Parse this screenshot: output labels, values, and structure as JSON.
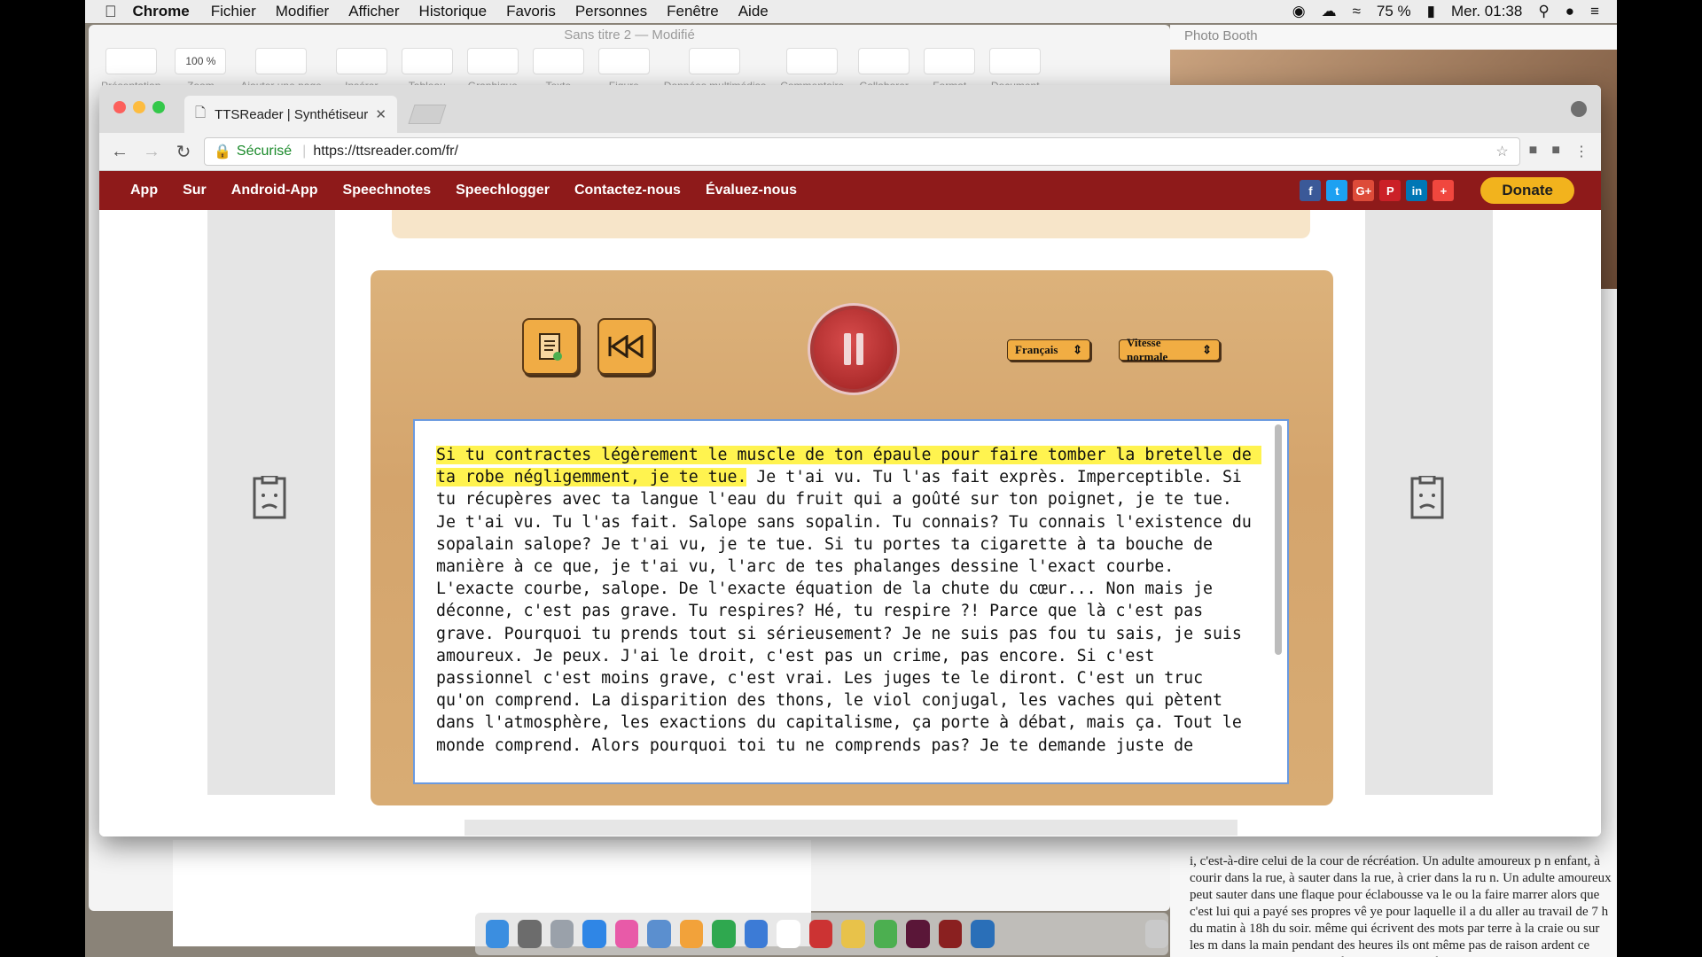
{
  "menubar": {
    "app": "Chrome",
    "items": [
      "Fichier",
      "Modifier",
      "Afficher",
      "Historique",
      "Favoris",
      "Personnes",
      "Fenêtre",
      "Aide"
    ],
    "battery": "75 %",
    "clock": "Mer. 01:38"
  },
  "pages": {
    "title": "Sans titre 2 — Modifié",
    "zoom": "100 %",
    "tools": [
      "Présentation",
      "Zoom",
      "Ajouter une page",
      "Insérer",
      "Tableau",
      "Graphique",
      "Texte",
      "Figure",
      "Données multimédias",
      "Commentaire",
      "Collaborer",
      "Format",
      "Document"
    ]
  },
  "photobooth": {
    "title": "Photo Booth",
    "text": "i, c'est-à-dire celui de la cour de récréation. Un adulte amoureux p n enfant, à courir dans la rue, à sauter dans la rue, à crier dans la ru n. Un adulte amoureux peut sauter dans une flaque pour éclabousse va le ou la faire marrer alors que c'est lui qui a payé ses propres vê ye pour laquelle il a du aller au travail de 7 h du matin à 18h du soir. même qui écrivent des mots par terre à la craie ou sur les m dans la main pendant des heures ils ont même pas de raison ardent ce qu'il y a autour et ils ne s'arrêtent que pour se faire"
  },
  "chrome": {
    "tab_title": "TTSReader | Synthétiseur voc",
    "secure_label": "Sécurisé",
    "url": "https://ttsreader.com/fr/"
  },
  "site": {
    "nav": [
      "App",
      "Sur",
      "Android-App",
      "Speechnotes",
      "Speechlogger",
      "Contactez-nous",
      "Évaluez-nous"
    ],
    "donate": "Donate"
  },
  "player": {
    "language": "Français",
    "speed": "Vitesse normale",
    "highlighted_text": "Si tu contractes légèrement le muscle de ton épaule pour faire tomber la bretelle de ta robe négligemment, je te tue.",
    "rest_text": " Je t'ai vu. Tu l'as fait exprès. Imperceptible. Si tu récupères avec ta langue l'eau du fruit qui a goûté sur ton poignet, je te tue. Je t'ai vu. Tu l'as fait. Salope sans sopalin. Tu connais? Tu connais l'existence du sopalain salope? Je t'ai vu, je te tue. Si tu portes ta cigarette à ta bouche de manière à ce que, je t'ai vu, l'arc de tes phalanges dessine l'exact courbe. L'exacte courbe, salope. De l'exacte équation de la chute du cœur... Non mais je déconne, c'est pas grave. Tu respires? Hé, tu respire ?! Parce que là c'est pas grave. Pourquoi tu prends tout si sérieusement? Je ne suis pas fou tu sais, je suis amoureux. Je peux. J'ai le droit, c'est pas un crime, pas encore. Si c'est passionnel c'est moins grave, c'est vrai. Les juges te le diront. C'est un truc qu'on comprend. La disparition des thons, le viol conjugal, les vaches qui pètent dans l'atmosphère, les exactions du capitalisme, ça porte à débat, mais ça. Tout le monde comprend. Alors pourquoi toi tu ne comprends pas? Je te demande juste de"
  }
}
